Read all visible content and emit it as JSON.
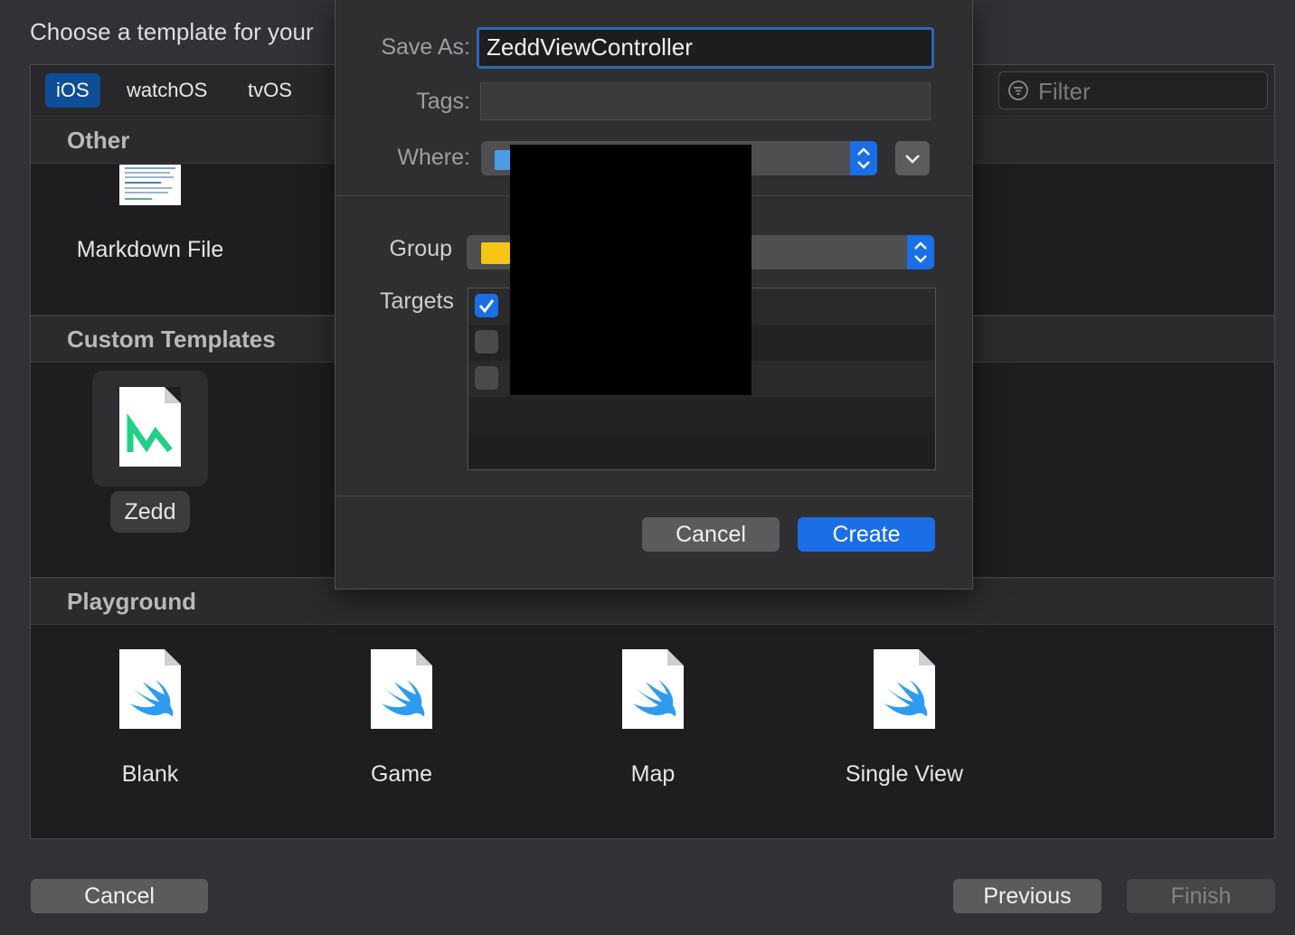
{
  "window": {
    "title": "Choose a template for your"
  },
  "platform_tabs": [
    {
      "label": "iOS",
      "selected": true
    },
    {
      "label": "watchOS",
      "selected": false
    },
    {
      "label": "tvOS",
      "selected": false
    }
  ],
  "filter": {
    "placeholder": "Filter"
  },
  "sections": {
    "other": {
      "label": "Other",
      "items": [
        {
          "label": "Markdown File"
        }
      ]
    },
    "custom": {
      "label": "Custom Templates",
      "items": [
        {
          "label": "Zedd"
        }
      ]
    },
    "playground": {
      "label": "Playground",
      "items": [
        {
          "label": "Blank"
        },
        {
          "label": "Game"
        },
        {
          "label": "Map"
        },
        {
          "label": "Single View"
        }
      ]
    }
  },
  "footer": {
    "cancel_label": "Cancel",
    "previous_label": "Previous",
    "finish_label": "Finish"
  },
  "save_sheet": {
    "save_as_label": "Save As:",
    "save_as_value": "ZeddViewController",
    "tags_label": "Tags:",
    "tags_value": "",
    "where_label": "Where:",
    "group_label": "Group",
    "targets_label": "Targets",
    "targets": [
      {
        "checked": true
      },
      {
        "checked": false
      },
      {
        "checked": false
      }
    ],
    "cancel_label": "Cancel",
    "create_label": "Create"
  },
  "colors": {
    "accent": "#1a6ee6",
    "selected_tab": "#0f4d97",
    "background": "#323236"
  }
}
